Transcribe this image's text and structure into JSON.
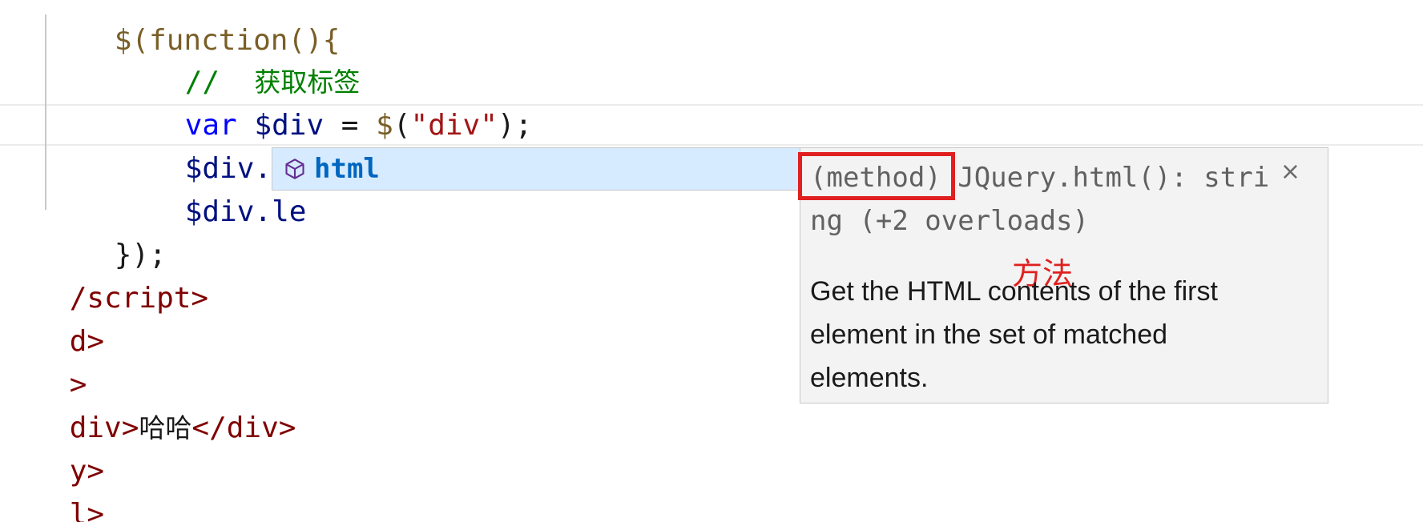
{
  "code": {
    "line0": "$(function(){",
    "comment_slashes": "//",
    "comment_text": "获取标签",
    "line2": {
      "kw": "var",
      "var": "$div",
      "eq": " = ",
      "fn": "$",
      "open": "(",
      "str": "\"div\"",
      "close": ");"
    },
    "line3": {
      "var": "$div",
      "member": ".html"
    },
    "line4": {
      "var": "$div",
      "member": ".le"
    },
    "line5": "});",
    "line6": "/script>",
    "line7": "d>",
    "line8": ">",
    "line9": {
      "open": "div>",
      "text": "哈哈",
      "close": "</div>"
    },
    "line10": "y>",
    "line11": "l>"
  },
  "suggest": {
    "icon": "method-cube-icon",
    "label": "html"
  },
  "details": {
    "signature_kind": "(method)",
    "signature_rest": " JQuery.html(): string (+2 overloads)",
    "close": "×",
    "annotation": "方法",
    "doc": "Get the HTML contents of the first element in the set of matched elements."
  },
  "colors": {
    "highlight": "#e02020",
    "suggest_bg": "#d6ebff",
    "details_bg": "#f3f3f3"
  }
}
